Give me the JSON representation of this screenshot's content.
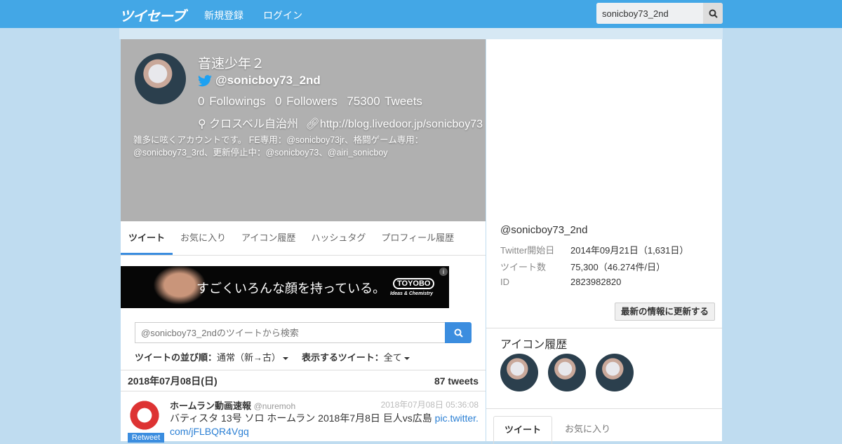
{
  "header": {
    "logo": "ツイセーブ",
    "nav": [
      "新規登録",
      "ログイン"
    ],
    "search_value": "sonicboy73_2nd"
  },
  "profile": {
    "name": "音速少年２",
    "handle": "@sonicboy73_2nd",
    "followings": "0",
    "followings_label": "Followings",
    "followers": "0",
    "followers_label": "Followers",
    "tweets": "75300",
    "tweets_label": "Tweets",
    "location": "クロスベル自治州",
    "url": "http://blog.livedoor.jp/sonicboy73",
    "bio": "雑多に呟くアカウントです。 FE専用：@sonicboy73jr、格闘ゲーム専用：@sonicboy73_3rd、更新停止中：@sonicboy73、@airi_sonicboy"
  },
  "tabs": [
    "ツイート",
    "お気に入り",
    "アイコン履歴",
    "ハッシュタグ",
    "プロフィール履歴"
  ],
  "ad": {
    "text": "すごくいろんな顔を持っている。",
    "brand": "TOYOBO",
    "tagline": "Ideas & Chemistry"
  },
  "tweet_search": {
    "placeholder": "@sonicboy73_2ndのツイートから検索"
  },
  "sort": {
    "label": "ツイートの並び順：",
    "value": "通常（新→古）",
    "filter_label": "表示するツイート：",
    "filter_value": "全て"
  },
  "day": {
    "date": "2018年07月08日(日)",
    "count": "87 tweets"
  },
  "tweet": {
    "name": "ホームラン動画速報",
    "handle": "@nuremoh",
    "time": "2018年07月08日 05:36:08",
    "text": "バティスタ 13号 ソロ ホームラン 2018年7月8日 巨人vs広島 ",
    "link": "pic.twitter.com/jFLBQR4Vgq",
    "badge": "Retweet"
  },
  "info": {
    "handle": "@sonicboy73_2nd",
    "rows": [
      {
        "k": "Twitter開始日",
        "v": "2014年09月21日（1,631日）"
      },
      {
        "k": "ツイート数",
        "v": "75,300（46.274件/日）"
      },
      {
        "k": "ID",
        "v": "2823982820"
      }
    ],
    "refresh": "最新の情報に更新する",
    "icon_history": "アイコン履歴",
    "tabs": [
      "ツイート",
      "お気に入り"
    ]
  }
}
